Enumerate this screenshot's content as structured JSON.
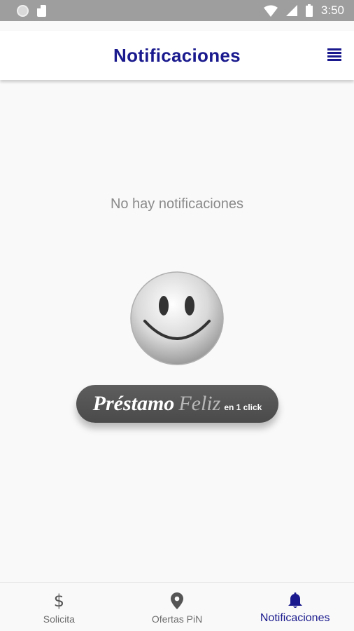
{
  "status_bar": {
    "time": "3:50"
  },
  "app_bar": {
    "title": "Notificaciones"
  },
  "empty_state": {
    "message": "No hay notificaciones"
  },
  "brand": {
    "word1": "Préstamo",
    "word2": "Feliz",
    "tagline": "en 1 click"
  },
  "bottom_nav": {
    "items": [
      {
        "label": "Solicita",
        "icon": "dollar-icon"
      },
      {
        "label": "Ofertas PiN",
        "icon": "location-pin-icon"
      },
      {
        "label": "Notificaciones",
        "icon": "bell-icon",
        "active": true
      }
    ]
  },
  "colors": {
    "accent": "#1a1a8e",
    "status_bar": "#9e9e9e",
    "muted_text": "#8a8a8a"
  }
}
